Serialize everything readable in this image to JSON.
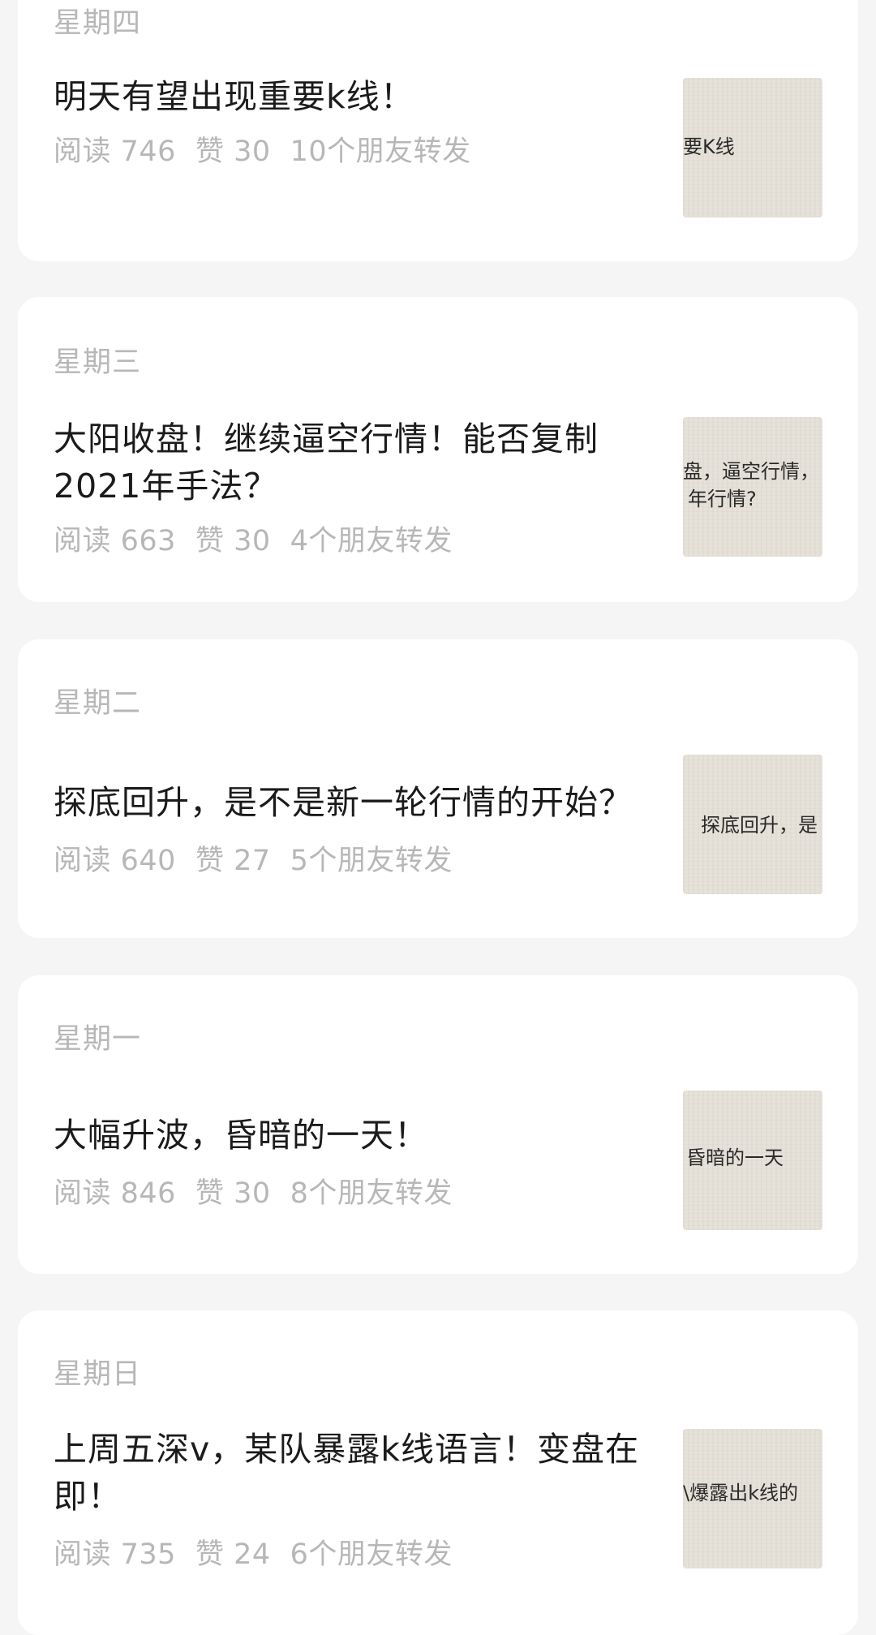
{
  "articles": [
    {
      "day": "星期四",
      "title": "明天有望出现重要k线！",
      "reads": "阅读 746",
      "likes": "赞 30",
      "shares": "10个朋友转发",
      "thumb_text": "要K线",
      "thumb_text_2": ""
    },
    {
      "day": "星期三",
      "title": "大阳收盘！继续逼空行情！能否复制2021年手法？",
      "reads": "阅读 663",
      "likes": "赞 30",
      "shares": "4个朋友转发",
      "thumb_text": "盘，逼空行情，",
      "thumb_text_2": "年行情?"
    },
    {
      "day": "星期二",
      "title": "探底回升，是不是新一轮行情的开始？",
      "reads": "阅读 640",
      "likes": "赞 27",
      "shares": "5个朋友转发",
      "thumb_text": "探底回升，是",
      "thumb_text_2": ""
    },
    {
      "day": "星期一",
      "title": "大幅升波，昏暗的一天！",
      "reads": "阅读 846",
      "likes": "赞 30",
      "shares": "8个朋友转发",
      "thumb_text": "昏暗的一天",
      "thumb_text_2": ""
    },
    {
      "day": "星期日",
      "title": "上周五深v，某队暴露k线语言！变盘在即！",
      "reads": "阅读 735",
      "likes": "赞 24",
      "shares": "6个朋友转发",
      "thumb_text": "\\爆露出k线的",
      "thumb_text_2": ""
    }
  ]
}
